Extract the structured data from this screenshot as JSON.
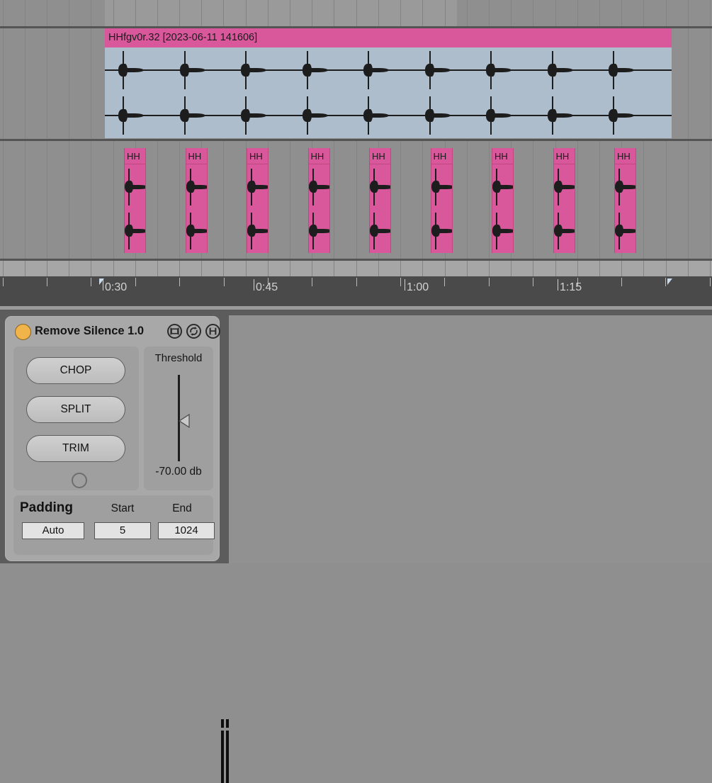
{
  "arrangement": {
    "audio_clip": {
      "name": "HHfgv0r.32 [2023-06-11 141606]",
      "color": "#d9589c",
      "waveform_color": "#aebdcb"
    },
    "chopped_clips": [
      {
        "label": "HH"
      },
      {
        "label": "HH"
      },
      {
        "label": "HH"
      },
      {
        "label": "HH"
      },
      {
        "label": "HH"
      },
      {
        "label": "HH"
      },
      {
        "label": "HH"
      },
      {
        "label": "HH"
      },
      {
        "label": "HH"
      }
    ],
    "ruler": {
      "labels": [
        "0:30",
        "0:45",
        "1:00",
        "1:15"
      ]
    }
  },
  "device": {
    "title": "Remove Silence 1.0",
    "led_color": "#f0b44a",
    "header_icons": [
      "device-icon",
      "refresh-icon",
      "save-icon"
    ],
    "buttons": {
      "chop": "CHOP",
      "split": "SPLIT",
      "trim": "TRIM"
    },
    "threshold": {
      "label": "Threshold",
      "value": "-70.00 db"
    },
    "padding": {
      "title": "Padding",
      "start_label": "Start",
      "end_label": "End",
      "mode": "Auto",
      "start_value": "5",
      "end_value": "1024"
    }
  }
}
